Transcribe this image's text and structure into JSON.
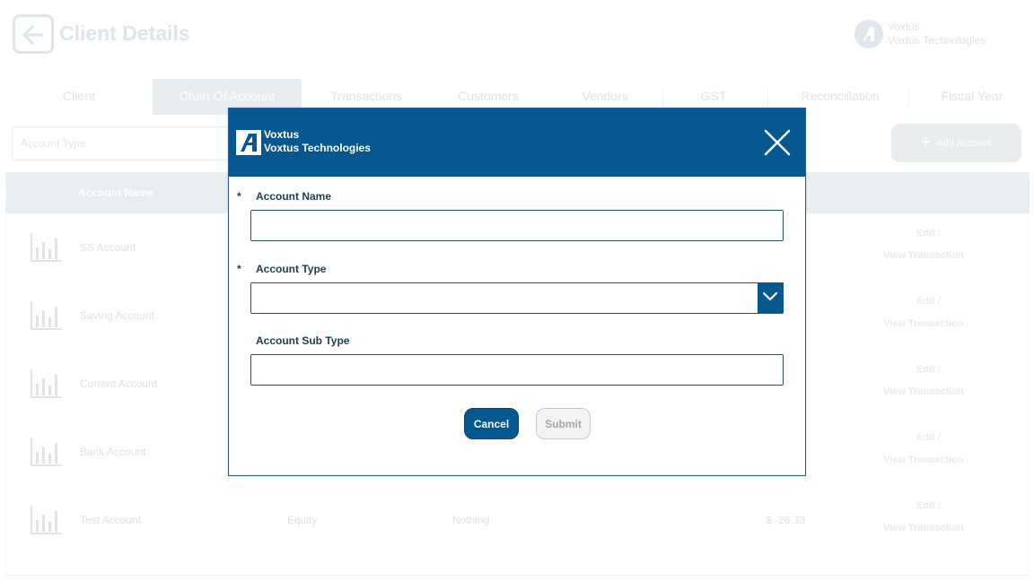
{
  "page": {
    "title": "Client Details",
    "brand_name": "Voxtus",
    "brand_company": "Voxtus Technologies"
  },
  "tabs": [
    {
      "label": "Client"
    },
    {
      "label": "Chart Of Account"
    },
    {
      "label": "Transactions"
    },
    {
      "label": "Customers"
    },
    {
      "label": "Vendors"
    },
    {
      "label": "GST"
    },
    {
      "label": "Reconciliation"
    },
    {
      "label": "Fiscal Year"
    }
  ],
  "active_tab": "Chart Of Account",
  "filter": {
    "placeholder": "Account Type"
  },
  "add_account_label": "Add Account",
  "table": {
    "header_name": "Account Name",
    "rows": [
      {
        "name": "SS Account",
        "type": "",
        "sub_type": "",
        "balance": "",
        "edit": "Edit /",
        "view": "View Transaction"
      },
      {
        "name": "Saving Account",
        "type": "",
        "sub_type": "",
        "balance": "",
        "edit": "Edit /",
        "view": "View Transaction"
      },
      {
        "name": "Current Account",
        "type": "",
        "sub_type": "",
        "balance": "",
        "edit": "Edit /",
        "view": "View Transaction"
      },
      {
        "name": "Bank Account",
        "type": "",
        "sub_type": "",
        "balance": "",
        "edit": "Edit /",
        "view": "View Transaction"
      },
      {
        "name": "Test Account",
        "type": "Equity",
        "sub_type": "Nothing",
        "balance": "$ -26.33",
        "edit": "Edit /",
        "view": "View Transaction"
      }
    ]
  },
  "modal": {
    "brand_name": "Voxtus",
    "brand_company": "Voxtus Technologies",
    "required_mark": "*",
    "fields": {
      "account_name": {
        "label": "Account Name",
        "value": "",
        "required": true
      },
      "account_type": {
        "label": "Account Type",
        "value": "",
        "required": true
      },
      "account_sub_type": {
        "label": "Account Sub Type",
        "value": "",
        "required": false
      }
    },
    "cancel_label": "Cancel",
    "submit_label": "Submit"
  },
  "colors": {
    "primary": "#05578f",
    "label": "#19405f",
    "disabled_text": "#a5a5a5"
  }
}
